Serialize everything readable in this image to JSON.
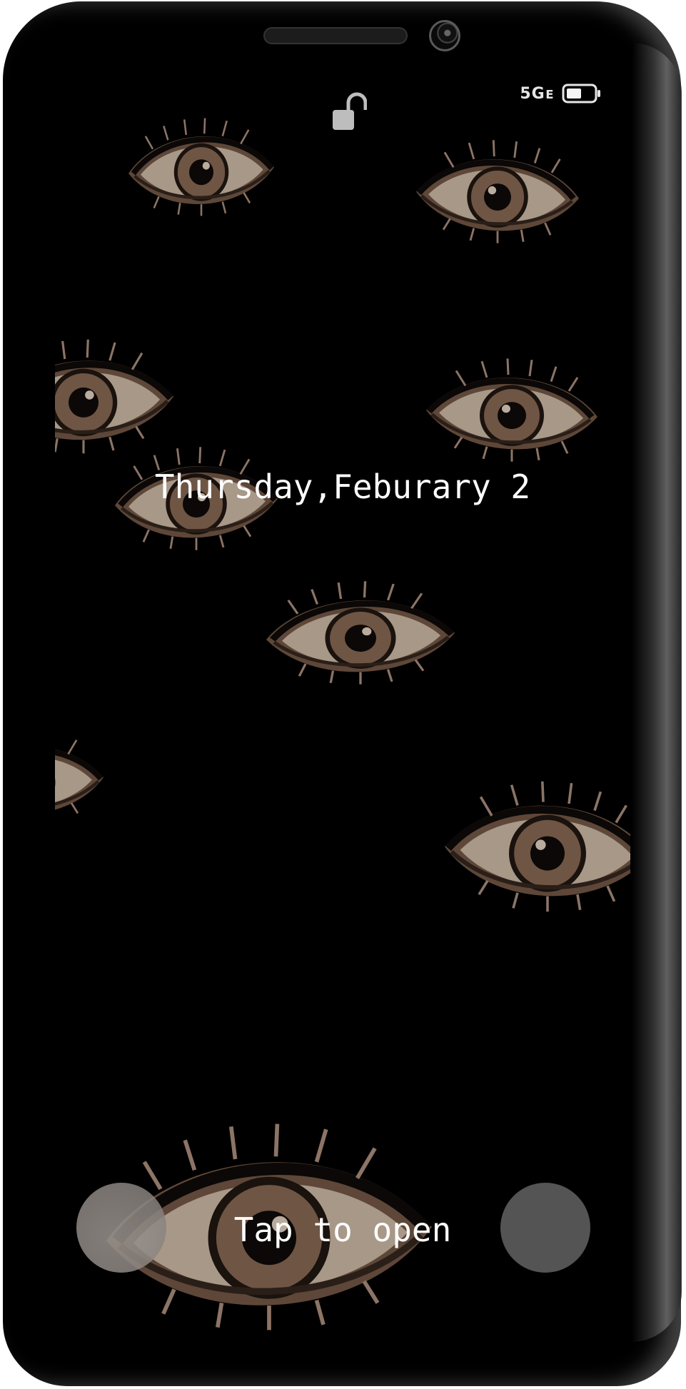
{
  "status_bar": {
    "lock_icon": "unlocked-padlock-icon",
    "network": "5Gᴇ",
    "battery_icon": "battery-icon"
  },
  "lockscreen": {
    "date": "Thursday,Feburary 2",
    "tap_prompt": "Tap to open",
    "left_shortcut_icon": "circle-shortcut-icon",
    "right_shortcut_icon": "circle-shortcut-icon",
    "wallpaper": "eyes-wallpaper"
  },
  "colors": {
    "screen_bg": "#000000",
    "text": "#ffffff",
    "eye_skin": "#9a7b66",
    "eye_white": "#a89a8c"
  }
}
